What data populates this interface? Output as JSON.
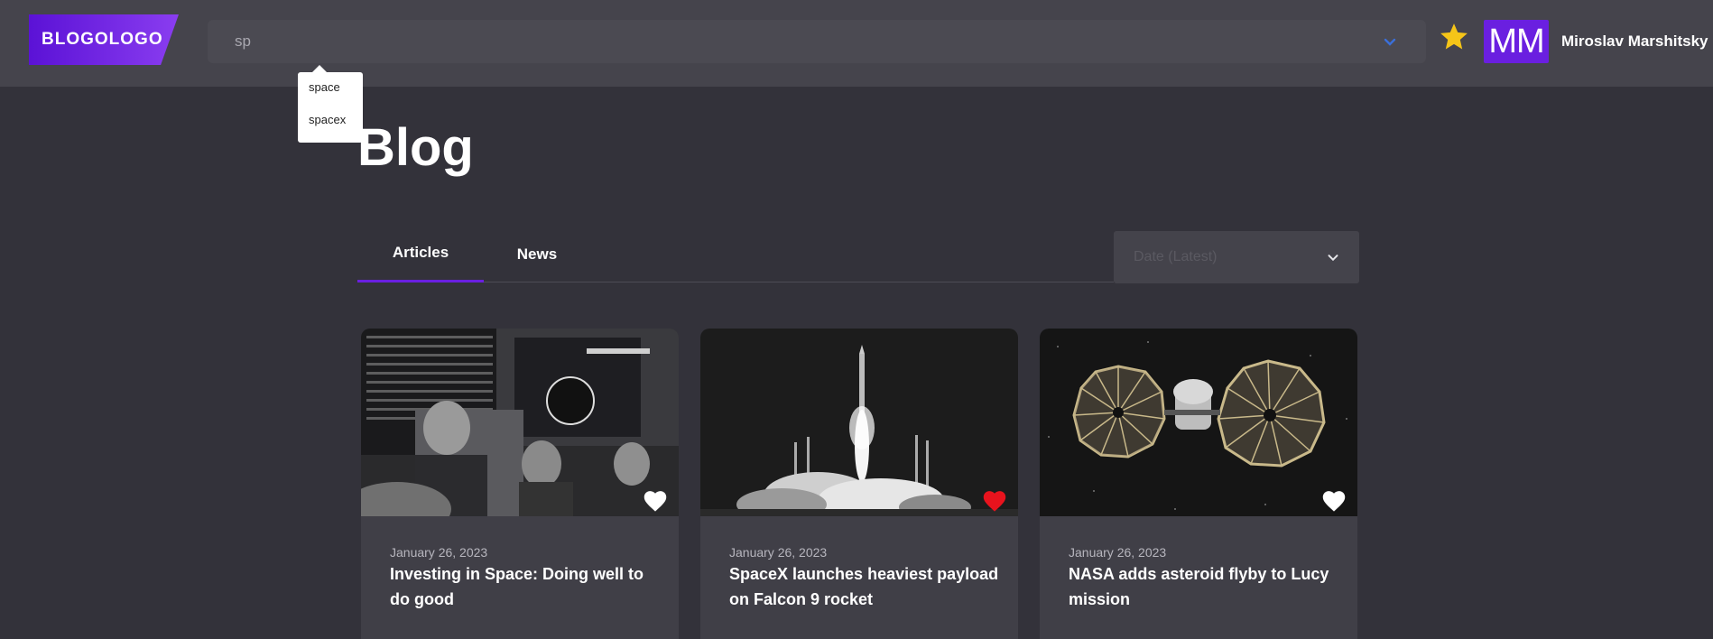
{
  "header": {
    "logo_text": "BLOGOLOGO",
    "search": {
      "value": "sp",
      "placeholder": ""
    },
    "avatar_initials": "MM",
    "username": "Miroslav Marshitsky"
  },
  "search_suggestions": [
    "space",
    "spacex"
  ],
  "page": {
    "title": "Blog",
    "tabs": [
      {
        "label": "Articles",
        "active": true
      },
      {
        "label": "News",
        "active": false
      }
    ],
    "sort": {
      "placeholder": "Date (Latest)"
    }
  },
  "cards": [
    {
      "date": "January 26, 2023",
      "title": "Investing in Space: Doing well to do good",
      "favorited": false
    },
    {
      "date": "January 26, 2023",
      "title": "SpaceX launches heaviest payload on Falcon 9 rocket",
      "favorited": true
    },
    {
      "date": "January 26, 2023",
      "title": "NASA adds asteroid flyby to Lucy mission",
      "favorited": false
    }
  ],
  "colors": {
    "accent": "#6a1fe0",
    "background": "#33323a",
    "header": "#45444c",
    "card": "#403f47",
    "heart_active": "#e8131d",
    "star": "#f5c518"
  },
  "icons": {
    "search_caret": "chevron-down-icon",
    "favorite": "star-icon",
    "sort_chevron": "chevron-down-icon",
    "card_like": "heart-icon"
  }
}
